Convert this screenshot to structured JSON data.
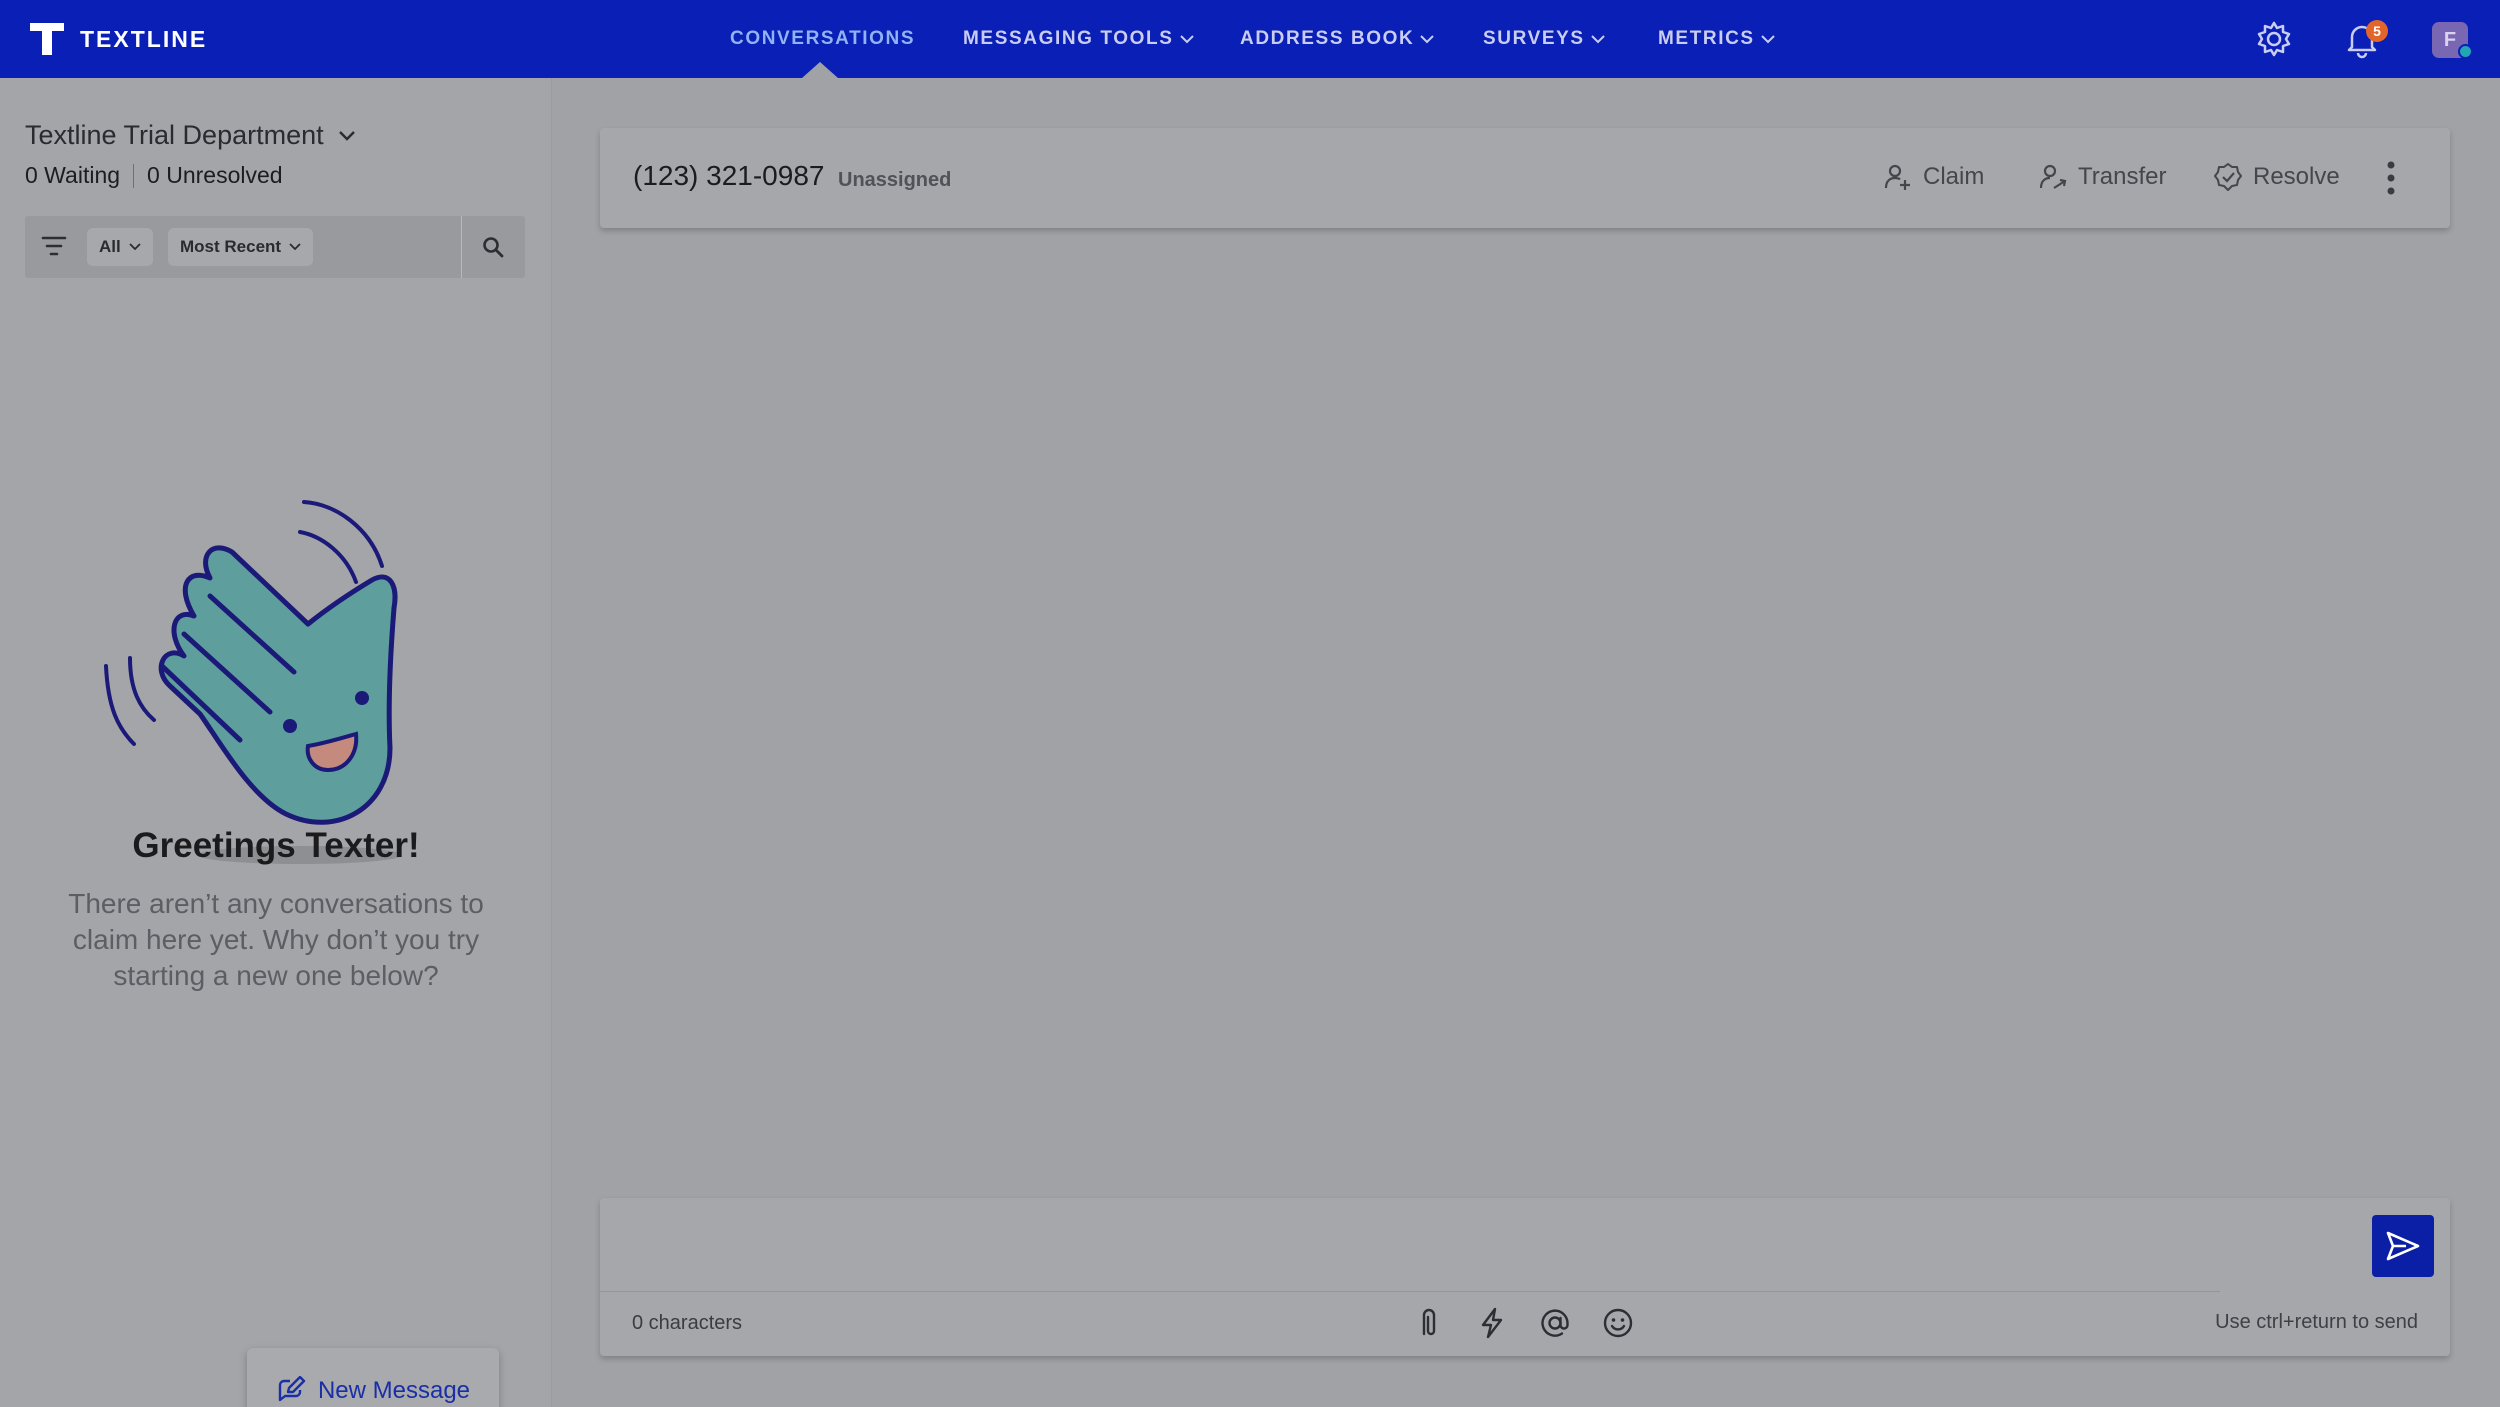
{
  "app": {
    "name": "TEXTLINE"
  },
  "nav": {
    "items": [
      {
        "label": "CONVERSATIONS",
        "active": true,
        "dropdown": false
      },
      {
        "label": "MESSAGING TOOLS",
        "active": false,
        "dropdown": true
      },
      {
        "label": "ADDRESS BOOK",
        "active": false,
        "dropdown": true
      },
      {
        "label": "SURVEYS",
        "active": false,
        "dropdown": true
      },
      {
        "label": "METRICS",
        "active": false,
        "dropdown": true
      }
    ],
    "notifications_count": "5",
    "avatar_initial": "F",
    "icons": [
      "gear-icon",
      "bell-icon"
    ]
  },
  "sidebar": {
    "department": "Textline Trial Department",
    "waiting": "0 Waiting",
    "unresolved": "0 Unresolved",
    "filter": {
      "scope": "All",
      "sort": "Most Recent"
    },
    "empty_state": {
      "title": "Greetings Texter!",
      "body": "There aren’t any conversations to claim here yet. Why don’t you try starting a new one below?"
    },
    "new_message_label": "New Message"
  },
  "conversation": {
    "phone": "(123) 321-0987",
    "assignment": "Unassigned",
    "actions": {
      "claim": "Claim",
      "transfer": "Transfer",
      "resolve": "Resolve"
    }
  },
  "composer": {
    "value": "",
    "char_count": "0 characters",
    "hint": "Use ctrl+return to send",
    "tools": [
      "paperclip-icon",
      "lightning-icon",
      "at-icon",
      "emoji-icon"
    ]
  },
  "colors": {
    "brand": "#0a1fb5",
    "overlay_background": "#a1a2a6",
    "badge": "#e2662c",
    "link": "#1a2ea6"
  }
}
